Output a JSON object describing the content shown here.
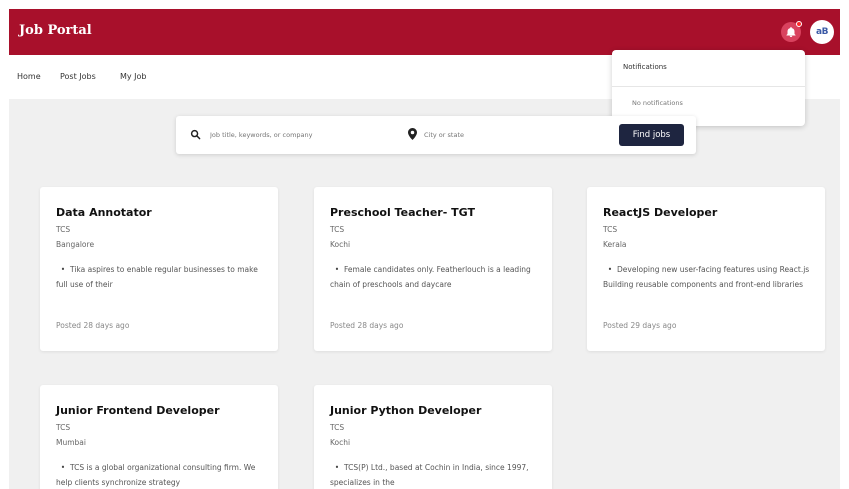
{
  "header": {
    "brand": "Job Portal",
    "avatar_initials": "aB"
  },
  "nav": {
    "items": [
      "Home",
      "Post Jobs",
      "My Job"
    ]
  },
  "notifications": {
    "title": "Notifications",
    "empty_text": "No notifications"
  },
  "search": {
    "keyword_placeholder": "Job title, keywords, or company",
    "location_placeholder": "City or state",
    "button_label": "Find jobs"
  },
  "jobs": [
    {
      "title": "Data Annotator",
      "company": "TCS",
      "location": "Bangalore",
      "description": "Tika aspires to enable regular businesses to make full use of their",
      "posted": "Posted 28 days ago"
    },
    {
      "title": "Preschool Teacher- TGT",
      "company": "TCS",
      "location": "Kochi",
      "description": "Female candidates only. Featherlouch is a leading chain of preschools and daycare",
      "posted": "Posted 28 days ago"
    },
    {
      "title": "ReactJS Developer",
      "company": "TCS",
      "location": "Kerala",
      "description": "Developing new user-facing features using React.js Building reusable components and front-end libraries",
      "posted": "Posted 29 days ago"
    },
    {
      "title": "Junior Frontend Developer",
      "company": "TCS",
      "location": "Mumbai",
      "description": "TCS is a global organizational consulting firm. We help clients synchronize strategy",
      "posted": ""
    },
    {
      "title": "Junior Python Developer",
      "company": "TCS",
      "location": "Kochi",
      "description": "TCS(P) Ltd., based at Cochin in India, since 1997, specializes in the",
      "posted": ""
    }
  ],
  "colors": {
    "header_bg": "#a8102b",
    "button_bg": "#1e2540",
    "page_bg": "#f0f0f0"
  }
}
